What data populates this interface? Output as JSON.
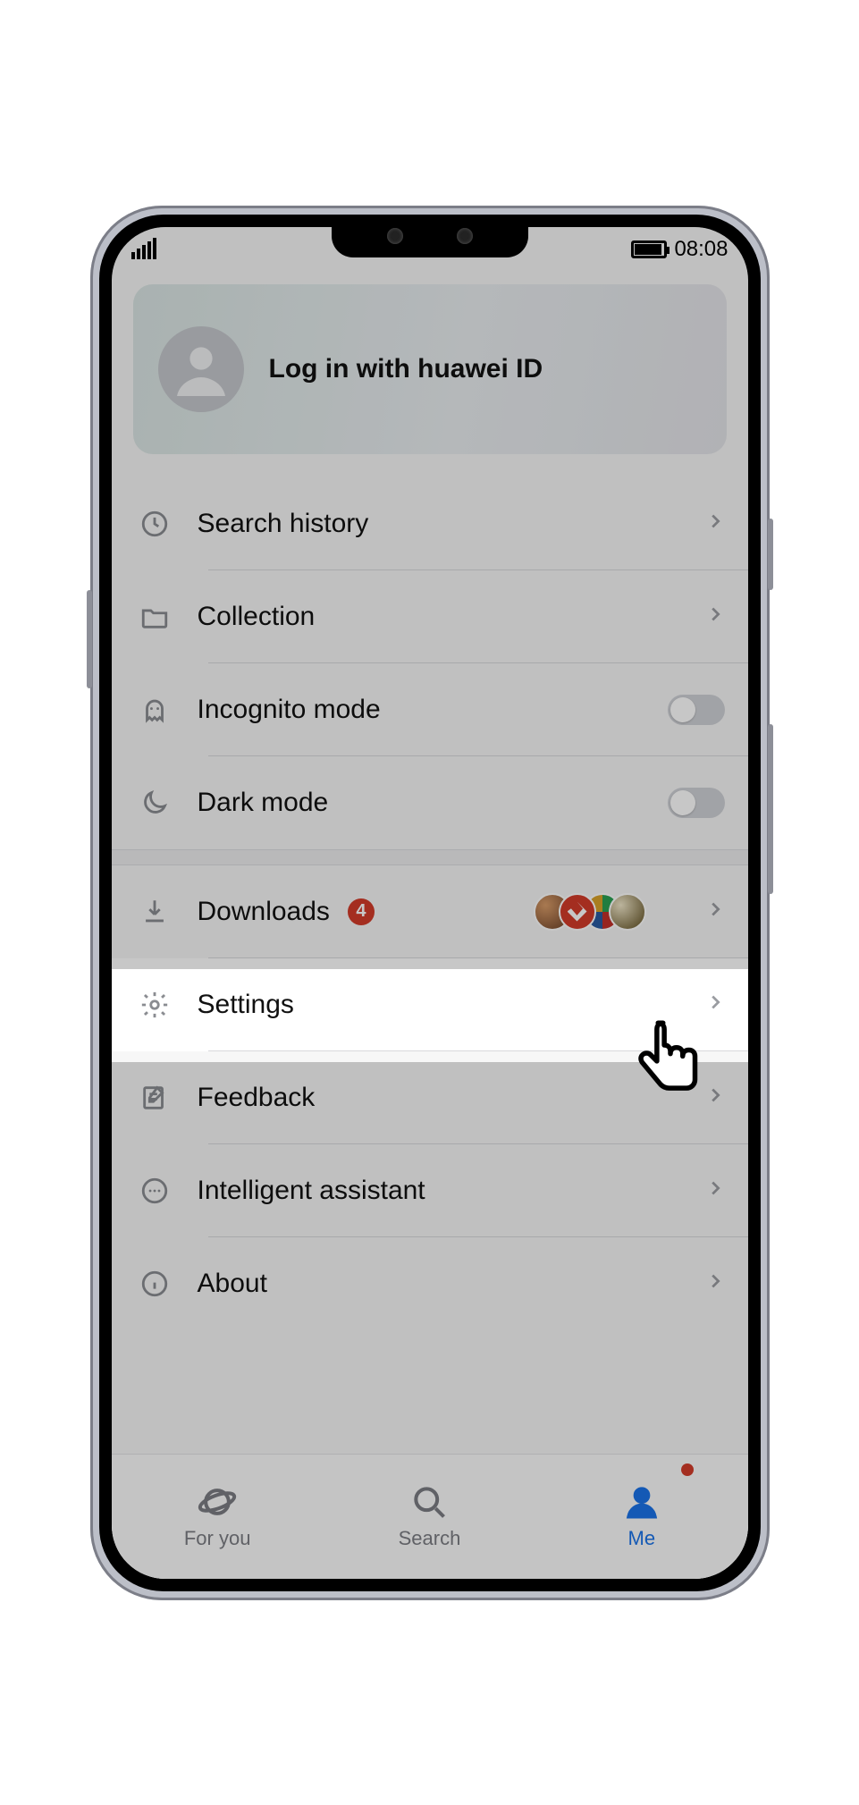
{
  "status": {
    "time": "08:08"
  },
  "login": {
    "label": "Log in with huawei ID"
  },
  "rows": {
    "search_history": "Search history",
    "collection": "Collection",
    "incognito": "Incognito mode",
    "dark_mode": "Dark mode",
    "downloads": "Downloads",
    "downloads_badge": "4",
    "settings": "Settings",
    "feedback": "Feedback",
    "intelligent": "Intelligent assistant",
    "about": "About"
  },
  "nav": {
    "for_you": "For you",
    "search": "Search",
    "me": "Me"
  },
  "toggles": {
    "incognito": false,
    "dark_mode": false
  }
}
